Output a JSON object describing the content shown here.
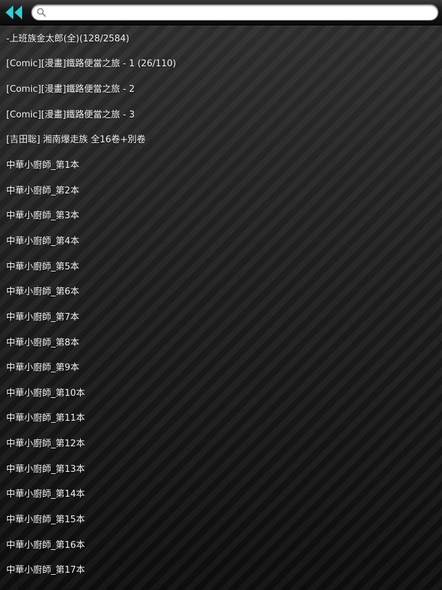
{
  "search": {
    "placeholder": "",
    "value": ""
  },
  "colors": {
    "back_arrow": "#2bd0d6",
    "row_text": "#f4f4f4"
  },
  "icons": {
    "back": "double-left-arrow-icon",
    "search": "magnifier-icon"
  },
  "items": [
    {
      "label": "-上班族金太郎(全)(128/2584)"
    },
    {
      "label": "[Comic][漫畫]鐵路便當之旅 - 1 (26/110)"
    },
    {
      "label": "[Comic][漫畫]鐵路便當之旅 - 2"
    },
    {
      "label": "[Comic][漫畫]鐵路便當之旅 - 3"
    },
    {
      "label": "[吉田聡] 湘南爆走族 全16卷+別卷"
    },
    {
      "label": "中華小廚師_第1本"
    },
    {
      "label": "中華小廚師_第2本"
    },
    {
      "label": "中華小廚師_第3本"
    },
    {
      "label": "中華小廚師_第4本"
    },
    {
      "label": "中華小廚師_第5本"
    },
    {
      "label": "中華小廚師_第6本"
    },
    {
      "label": "中華小廚師_第7本"
    },
    {
      "label": "中華小廚師_第8本"
    },
    {
      "label": "中華小廚師_第9本"
    },
    {
      "label": "中華小廚師_第10本"
    },
    {
      "label": "中華小廚師_第11本"
    },
    {
      "label": "中華小廚師_第12本"
    },
    {
      "label": "中華小廚師_第13本"
    },
    {
      "label": "中華小廚師_第14本"
    },
    {
      "label": "中華小廚師_第15本"
    },
    {
      "label": "中華小廚師_第16本"
    },
    {
      "label": "中華小廚師_第17本"
    }
  ]
}
